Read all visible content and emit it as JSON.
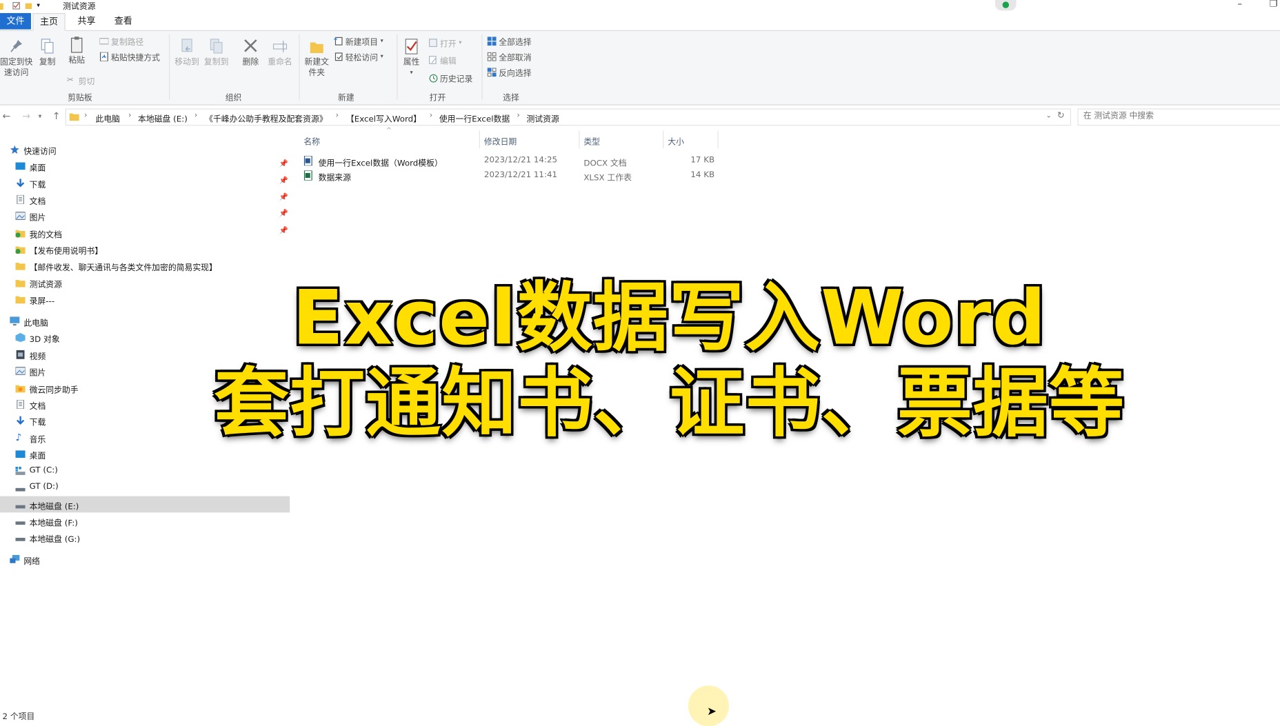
{
  "window": {
    "title": "测试资源",
    "minimize": "–",
    "maximize": "❐"
  },
  "ribbon_tabs": [
    "文件",
    "主页",
    "共享",
    "查看"
  ],
  "ribbon": {
    "clipboard": {
      "pin_quick_access": "固定到快速访问",
      "copy": "复制",
      "paste": "粘贴",
      "copy_path": "复制路径",
      "paste_shortcut": "粘贴快捷方式",
      "cut": "剪切",
      "group": "剪贴板"
    },
    "organize": {
      "move_to": "移动到",
      "copy_to": "复制到",
      "delete": "删除",
      "rename": "重命名",
      "group": "组织"
    },
    "new": {
      "new_folder": "新建文件夹",
      "new_item": "新建项目",
      "easy_access": "轻松访问",
      "group": "新建"
    },
    "open": {
      "properties": "属性",
      "open": "打开",
      "edit": "编辑",
      "history": "历史记录",
      "group": "打开"
    },
    "select": {
      "select_all": "全部选择",
      "select_none": "全部取消",
      "invert": "反向选择",
      "group": "选择"
    }
  },
  "address": {
    "crumbs": [
      "此电脑",
      "本地磁盘 (E:)",
      "《千峰办公助手教程及配套资源》",
      "【Excel写入Word】",
      "使用一行Excel数据",
      "测试资源"
    ],
    "search_placeholder": "在 测试资源 中搜索"
  },
  "nav_pane": {
    "quick_access": "快速访问",
    "quick_items": [
      "桌面",
      "下载",
      "文档",
      "图片",
      "我的文档",
      "【发布使用说明书】",
      "【邮件收发、聊天通讯与各类文件加密的简易实现】",
      "测试资源",
      "录屏---"
    ],
    "this_pc": "此电脑",
    "pc_items": [
      "3D 对象",
      "视频",
      "图片",
      "微云同步助手",
      "文档",
      "下载",
      "音乐",
      "桌面",
      "GT (C:)",
      "GT (D:)",
      "本地磁盘 (E:)",
      "本地磁盘 (F:)",
      "本地磁盘 (G:)"
    ],
    "network": "网络"
  },
  "file_list": {
    "columns": [
      "名称",
      "修改日期",
      "类型",
      "大小"
    ],
    "rows": [
      {
        "name": "使用一行Excel数据（Word模板）",
        "date": "2023/12/21 14:25",
        "type": "DOCX 文档",
        "size": "17 KB"
      },
      {
        "name": "数据来源",
        "date": "2023/12/21 11:41",
        "type": "XLSX 工作表",
        "size": "14 KB"
      }
    ]
  },
  "status": "2 个项目",
  "caption": {
    "line1": "Excel数据写入Word",
    "line2": "套打通知书、证书、票据等"
  }
}
